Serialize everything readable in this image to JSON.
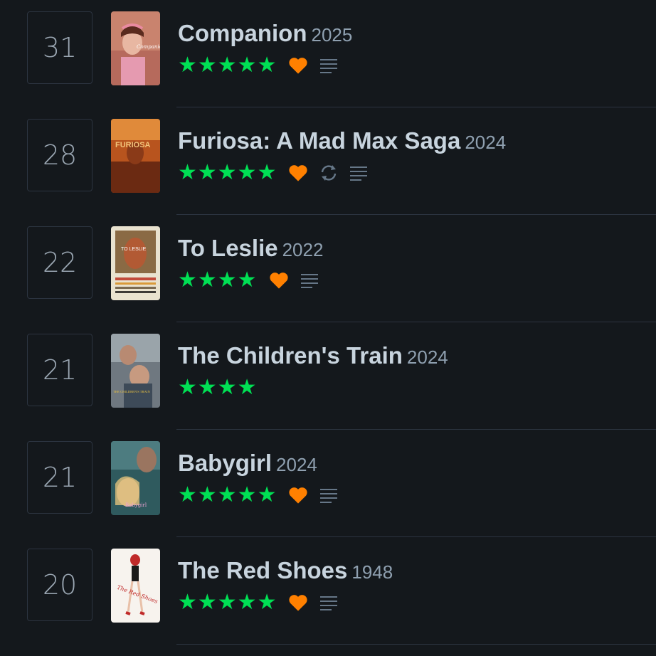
{
  "diary": [
    {
      "day": "31",
      "title": "Companion",
      "year": "2025",
      "rating": "★★★★★",
      "liked": true,
      "rewatch": false,
      "review": true,
      "poster_label": "Companion"
    },
    {
      "day": "28",
      "title": "Furiosa: A Mad Max Saga",
      "year": "2024",
      "rating": "★★★★★",
      "liked": true,
      "rewatch": true,
      "review": true,
      "poster_label": "FURIOSA"
    },
    {
      "day": "22",
      "title": "To Leslie",
      "year": "2022",
      "rating": "★★★★",
      "liked": true,
      "rewatch": false,
      "review": true,
      "poster_label": "TO LESLIE"
    },
    {
      "day": "21",
      "title": "The Children's Train",
      "year": "2024",
      "rating": "★★★★",
      "liked": false,
      "rewatch": false,
      "review": false,
      "poster_label": "THE CHILDREN'S TRAIN"
    },
    {
      "day": "21",
      "title": "Babygirl",
      "year": "2024",
      "rating": "★★★★★",
      "liked": true,
      "rewatch": false,
      "review": true,
      "poster_label": "Babygirl"
    },
    {
      "day": "20",
      "title": "The Red Shoes",
      "year": "1948",
      "rating": "★★★★★",
      "liked": true,
      "rewatch": false,
      "review": true,
      "poster_label": "The Red Shoes"
    }
  ],
  "colors": {
    "background": "#14181c",
    "star": "#00e054",
    "heart": "#ff8000",
    "muted_icon": "#678",
    "title": "#c8d4de"
  },
  "icons": {
    "like": "heart-icon",
    "rewatch": "rewatch-icon",
    "review": "review-lines-icon"
  }
}
